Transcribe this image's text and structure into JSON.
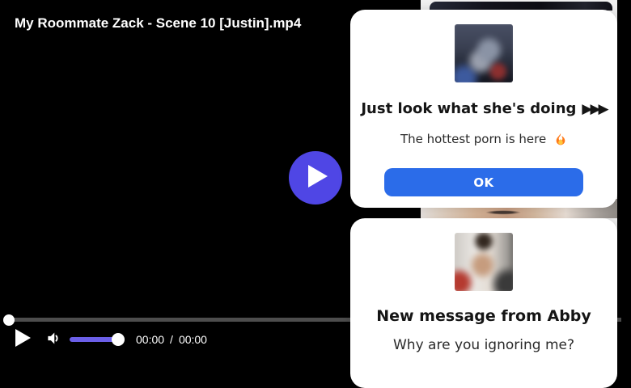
{
  "player": {
    "title": "My Roommate Zack - Scene 10 [Justin].mp4",
    "time_current": "00:00",
    "time_separator": "/",
    "time_duration": "00:00"
  },
  "popups": [
    {
      "heading": "Just look what she's doing",
      "heading_arrows": "▶▶▶",
      "subtext": "The hottest porn is here",
      "subtext_icon": "fire-emoji",
      "button_label": "OK",
      "thumbnail_name": "blurred-photo-thumbnail"
    },
    {
      "heading": "New message from Abby",
      "subtext": "Why are you ignoring me?",
      "thumbnail_name": "blurred-photo-thumbnail"
    }
  ],
  "colors": {
    "accent_play": "#4f46e5",
    "volume_slider": "#6b5fe8",
    "ok_button": "#2b6ce9"
  }
}
